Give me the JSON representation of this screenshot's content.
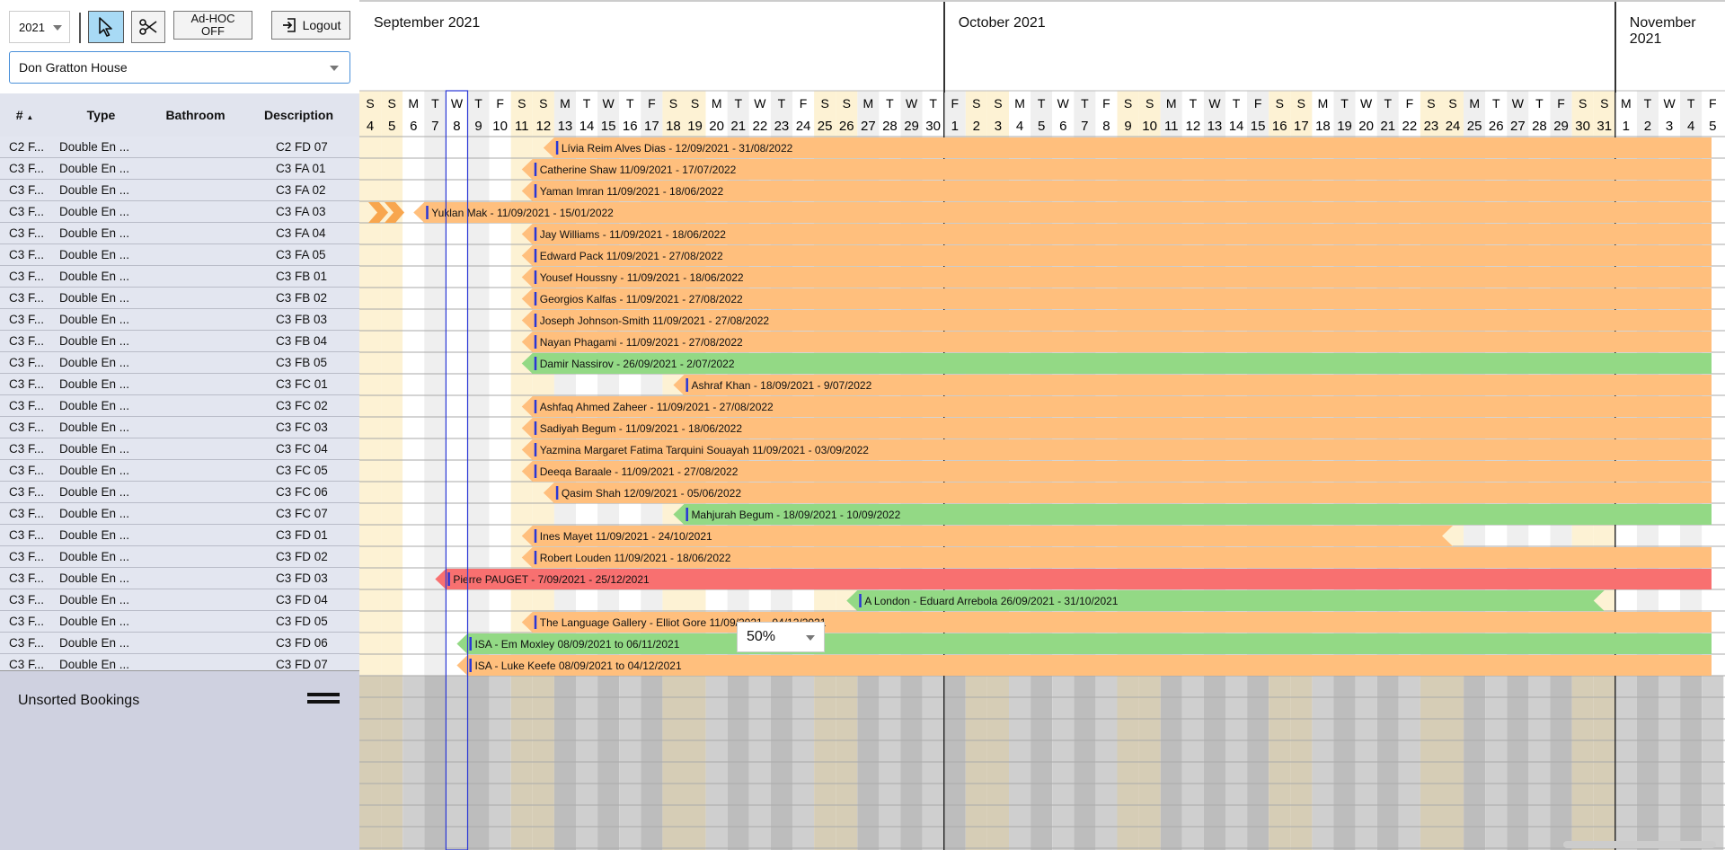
{
  "toolbar": {
    "year": "2021",
    "adhoc_line1": "Ad-HOC",
    "adhoc_line2": "OFF",
    "logout_label": "Logout",
    "property": "Don Gratton House"
  },
  "columns": {
    "num": "#",
    "type": "Type",
    "bathroom": "Bathroom",
    "description": "Description"
  },
  "months": [
    {
      "label": "September 2021"
    },
    {
      "label": "October 2021"
    },
    {
      "label": "November 2021"
    }
  ],
  "days": [
    {
      "w": "S",
      "d": "4",
      "wk": true
    },
    {
      "w": "S",
      "d": "5",
      "wk": true
    },
    {
      "w": "M",
      "d": "6"
    },
    {
      "w": "T",
      "d": "7"
    },
    {
      "w": "W",
      "d": "8",
      "today": true
    },
    {
      "w": "T",
      "d": "9"
    },
    {
      "w": "F",
      "d": "10"
    },
    {
      "w": "S",
      "d": "11",
      "wk": true
    },
    {
      "w": "S",
      "d": "12",
      "wk": true
    },
    {
      "w": "M",
      "d": "13"
    },
    {
      "w": "T",
      "d": "14"
    },
    {
      "w": "W",
      "d": "15"
    },
    {
      "w": "T",
      "d": "16"
    },
    {
      "w": "F",
      "d": "17"
    },
    {
      "w": "S",
      "d": "18",
      "wk": true
    },
    {
      "w": "S",
      "d": "19",
      "wk": true
    },
    {
      "w": "M",
      "d": "20"
    },
    {
      "w": "T",
      "d": "21"
    },
    {
      "w": "W",
      "d": "22"
    },
    {
      "w": "T",
      "d": "23"
    },
    {
      "w": "F",
      "d": "24"
    },
    {
      "w": "S",
      "d": "25",
      "wk": true
    },
    {
      "w": "S",
      "d": "26",
      "wk": true
    },
    {
      "w": "M",
      "d": "27"
    },
    {
      "w": "T",
      "d": "28"
    },
    {
      "w": "W",
      "d": "29"
    },
    {
      "w": "T",
      "d": "30"
    },
    {
      "w": "F",
      "d": "1",
      "ms": true
    },
    {
      "w": "S",
      "d": "2",
      "wk": true
    },
    {
      "w": "S",
      "d": "3",
      "wk": true
    },
    {
      "w": "M",
      "d": "4"
    },
    {
      "w": "T",
      "d": "5"
    },
    {
      "w": "W",
      "d": "6"
    },
    {
      "w": "T",
      "d": "7"
    },
    {
      "w": "F",
      "d": "8"
    },
    {
      "w": "S",
      "d": "9",
      "wk": true
    },
    {
      "w": "S",
      "d": "10",
      "wk": true
    },
    {
      "w": "M",
      "d": "11"
    },
    {
      "w": "T",
      "d": "12"
    },
    {
      "w": "W",
      "d": "13"
    },
    {
      "w": "T",
      "d": "14"
    },
    {
      "w": "F",
      "d": "15"
    },
    {
      "w": "S",
      "d": "16",
      "wk": true
    },
    {
      "w": "S",
      "d": "17",
      "wk": true
    },
    {
      "w": "M",
      "d": "18"
    },
    {
      "w": "T",
      "d": "19"
    },
    {
      "w": "W",
      "d": "20"
    },
    {
      "w": "T",
      "d": "21"
    },
    {
      "w": "F",
      "d": "22"
    },
    {
      "w": "S",
      "d": "23",
      "wk": true
    },
    {
      "w": "S",
      "d": "24",
      "wk": true
    },
    {
      "w": "M",
      "d": "25"
    },
    {
      "w": "T",
      "d": "26"
    },
    {
      "w": "W",
      "d": "27"
    },
    {
      "w": "T",
      "d": "28"
    },
    {
      "w": "F",
      "d": "29"
    },
    {
      "w": "S",
      "d": "30",
      "wk": true
    },
    {
      "w": "S",
      "d": "31",
      "wk": true
    },
    {
      "w": "M",
      "d": "1",
      "ms": true
    },
    {
      "w": "T",
      "d": "2"
    },
    {
      "w": "W",
      "d": "3"
    },
    {
      "w": "T",
      "d": "4"
    },
    {
      "w": "F",
      "d": "5"
    }
  ],
  "rooms": [
    {
      "num": "C2 F...",
      "type": "Double En ...",
      "desc": "C2 FD 07"
    },
    {
      "num": "C3 F...",
      "type": "Double En ...",
      "desc": "C3 FA 01"
    },
    {
      "num": "C3 F...",
      "type": "Double En ...",
      "desc": "C3 FA 02"
    },
    {
      "num": "C3 F...",
      "type": "Double En ...",
      "desc": "C3 FA 03"
    },
    {
      "num": "C3 F...",
      "type": "Double En ...",
      "desc": "C3 FA 04"
    },
    {
      "num": "C3 F...",
      "type": "Double En ...",
      "desc": "C3 FA 05"
    },
    {
      "num": "C3 F...",
      "type": "Double En ...",
      "desc": "C3 FB 01"
    },
    {
      "num": "C3 F...",
      "type": "Double En ...",
      "desc": "C3 FB 02"
    },
    {
      "num": "C3 F...",
      "type": "Double En ...",
      "desc": "C3 FB 03"
    },
    {
      "num": "C3 F...",
      "type": "Double En ...",
      "desc": "C3 FB 04"
    },
    {
      "num": "C3 F...",
      "type": "Double En ...",
      "desc": "C3 FB 05"
    },
    {
      "num": "C3 F...",
      "type": "Double En ...",
      "desc": "C3 FC 01"
    },
    {
      "num": "C3 F...",
      "type": "Double En ...",
      "desc": "C3 FC 02"
    },
    {
      "num": "C3 F...",
      "type": "Double En ...",
      "desc": "C3 FC 03"
    },
    {
      "num": "C3 F...",
      "type": "Double En ...",
      "desc": "C3 FC 04"
    },
    {
      "num": "C3 F...",
      "type": "Double En ...",
      "desc": "C3 FC 05"
    },
    {
      "num": "C3 F...",
      "type": "Double En ...",
      "desc": "C3 FC 06"
    },
    {
      "num": "C3 F...",
      "type": "Double En ...",
      "desc": "C3 FC 07"
    },
    {
      "num": "C3 F...",
      "type": "Double En ...",
      "desc": "C3 FD 01"
    },
    {
      "num": "C3 F...",
      "type": "Double En ...",
      "desc": "C3 FD 02"
    },
    {
      "num": "C3 F...",
      "type": "Double En ...",
      "desc": "C3 FD 03"
    },
    {
      "num": "C3 F...",
      "type": "Double En ...",
      "desc": "C3 FD 04"
    },
    {
      "num": "C3 F...",
      "type": "Double En ...",
      "desc": "C3 FD 05"
    },
    {
      "num": "C3 F...",
      "type": "Double En ...",
      "desc": "C3 FD 06"
    },
    {
      "num": "C3 F...",
      "type": "Double En ...",
      "desc": "C3 FD 07"
    }
  ],
  "bookings": [
    {
      "row": 0,
      "start": "2021-09-12",
      "end": "2022-08-31",
      "label": "Lívia Reim Alves Dias - 12/09/2021 - 31/08/2022",
      "status": "orange"
    },
    {
      "row": 1,
      "start": "2021-09-11",
      "end": "2022-07-17",
      "label": "Catherine Shaw 11/09/2021 - 17/07/2022",
      "status": "orange"
    },
    {
      "row": 2,
      "start": "2021-09-11",
      "end": "2022-06-18",
      "label": "Yaman Imran 11/09/2021 - 18/06/2022",
      "status": "orange"
    },
    {
      "row": 3,
      "start": "2021-09-06",
      "end": "2022-01-15",
      "label": "Yuklan Mak - 11/09/2021 - 15/01/2022",
      "status": "orange",
      "prior": true
    },
    {
      "row": 4,
      "start": "2021-09-11",
      "end": "2022-06-18",
      "label": "Jay Williams - 11/09/2021 - 18/06/2022",
      "status": "orange"
    },
    {
      "row": 5,
      "start": "2021-09-11",
      "end": "2022-08-27",
      "label": "Edward Pack 11/09/2021 - 27/08/2022",
      "status": "orange"
    },
    {
      "row": 6,
      "start": "2021-09-11",
      "end": "2022-06-18",
      "label": "Yousef Houssny - 11/09/2021 - 18/06/2022",
      "status": "orange"
    },
    {
      "row": 7,
      "start": "2021-09-11",
      "end": "2022-08-27",
      "label": "Georgios Kalfas - 11/09/2021 - 27/08/2022",
      "status": "orange"
    },
    {
      "row": 8,
      "start": "2021-09-11",
      "end": "2022-08-27",
      "label": "Joseph Johnson-Smith 11/09/2021 - 27/08/2022",
      "status": "orange"
    },
    {
      "row": 9,
      "start": "2021-09-11",
      "end": "2022-08-27",
      "label": "Nayan Phagami - 11/09/2021 - 27/08/2022",
      "status": "orange"
    },
    {
      "row": 10,
      "start": "2021-09-11",
      "end": "2022-07-02",
      "label": "Damir Nassirov - 26/09/2021 - 2/07/2022",
      "status": "green"
    },
    {
      "row": 11,
      "start": "2021-09-18",
      "end": "2022-07-09",
      "label": "Ashraf Khan - 18/09/2021 - 9/07/2022",
      "status": "orange"
    },
    {
      "row": 12,
      "start": "2021-09-11",
      "end": "2022-08-27",
      "label": "Ashfaq Ahmed Zaheer - 11/09/2021 - 27/08/2022",
      "status": "orange"
    },
    {
      "row": 13,
      "start": "2021-09-11",
      "end": "2022-06-18",
      "label": "Sadiyah Begum - 11/09/2021 - 18/06/2022",
      "status": "orange"
    },
    {
      "row": 14,
      "start": "2021-09-11",
      "end": "2022-09-03",
      "label": "Yazmina Margaret Fatima Tarquini Souayah 11/09/2021 - 03/09/2022",
      "status": "orange"
    },
    {
      "row": 15,
      "start": "2021-09-11",
      "end": "2022-08-27",
      "label": "Deeqa Baraale - 11/09/2021 - 27/08/2022",
      "status": "orange"
    },
    {
      "row": 16,
      "start": "2021-09-12",
      "end": "2022-06-05",
      "label": "Qasim Shah 12/09/2021 - 05/06/2022",
      "status": "orange"
    },
    {
      "row": 17,
      "start": "2021-09-18",
      "end": "2022-09-10",
      "label": "Mahjurah Begum - 18/09/2021 - 10/09/2022",
      "status": "green"
    },
    {
      "row": 18,
      "start": "2021-09-11",
      "end": "2021-10-24",
      "label": "Ines Mayet 11/09/2021 - 24/10/2021",
      "status": "orange"
    },
    {
      "row": 19,
      "start": "2021-09-11",
      "end": "2022-06-18",
      "label": "Robert Louden 11/09/2021 - 18/06/2022",
      "status": "orange"
    },
    {
      "row": 20,
      "start": "2021-09-07",
      "end": "2021-12-25",
      "label": "Pierre PAUGET - 7/09/2021 - 25/12/2021",
      "status": "red"
    },
    {
      "row": 21,
      "start": "2021-09-26",
      "end": "2021-10-31",
      "label": "A London - Eduard Arrebola 26/09/2021 - 31/10/2021",
      "status": "green"
    },
    {
      "row": 22,
      "start": "2021-09-11",
      "end": "2021-12-04",
      "label": "The Language Gallery - Elliot Gore 11/09/2021 - 04/12/2021",
      "status": "orange"
    },
    {
      "row": 23,
      "start": "2021-09-08",
      "end": "2021-11-06",
      "label": "ISA - Em Moxley 08/09/2021 to 06/11/2021",
      "status": "green"
    },
    {
      "row": 24,
      "start": "2021-09-08",
      "end": "2021-12-04",
      "label": "ISA - Luke Keefe 08/09/2021 to 04/12/2021",
      "status": "orange"
    }
  ],
  "colors": {
    "orange": "#ffbf7d",
    "green": "#93d985",
    "red": "#f87070",
    "today": "#2a37d6",
    "weekend": "#fdf2d4"
  },
  "zoom": "50%",
  "unsorted": {
    "title": "Unsorted Bookings"
  }
}
